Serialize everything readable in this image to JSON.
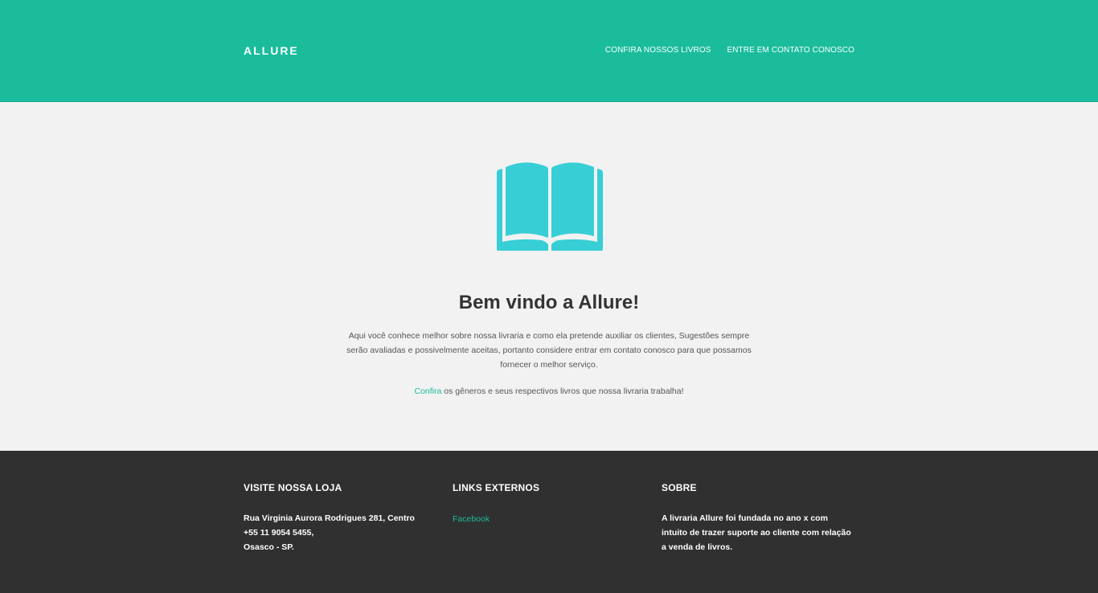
{
  "header": {
    "brand": "ALLURE",
    "nav": [
      {
        "label": "CONFIRA NOSSOS LIVROS"
      },
      {
        "label": "ENTRE EM CONTATO CONOSCO"
      }
    ]
  },
  "main": {
    "icon": "open-book-icon",
    "title": "Bem vindo a Allure!",
    "intro": "Aqui você conhece melhor sobre nossa livraria e como ela pretende auxiliar os clientes, Sugestões sempre serão avaliadas e possivelmente aceitas, portanto considere entrar em contato conosco para que possamos fornecer o melhor serviço.",
    "cta_link": "Confira",
    "cta_text": " os gêneros e seus respectivos livros que nossa livraria trabalha!"
  },
  "footer": {
    "store": {
      "heading": "VISITE NOSSA LOJA",
      "address": "Rua Virginia Aurora Rodrigues 281, Centro",
      "phone": "+55 11 9054 5455,",
      "city": "Osasco - SP."
    },
    "links": {
      "heading": "LINKS EXTERNOS",
      "facebook": "Facebook"
    },
    "about": {
      "heading": "SOBRE",
      "text": "A livraria Allure foi fundada no ano x com intuito de trazer suporte ao cliente com relação a venda de livros."
    }
  },
  "colors": {
    "accent": "#1abc9c",
    "icon": "#38ced6",
    "footer_bg": "#303030",
    "body_bg": "#f2f2f2"
  }
}
